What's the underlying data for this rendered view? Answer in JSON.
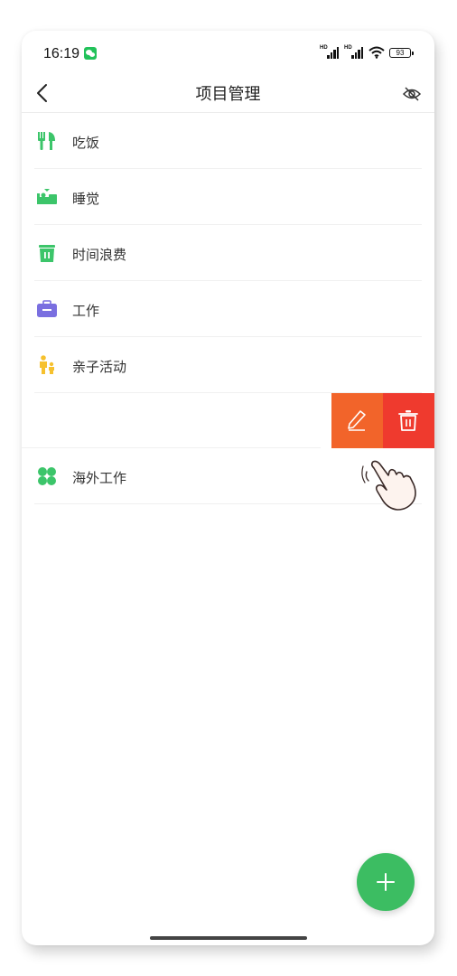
{
  "status_bar": {
    "time": "16:19",
    "hd1": "HD",
    "hd2": "HD",
    "battery": "93"
  },
  "nav": {
    "title": "项目管理"
  },
  "items": [
    {
      "label": "吃饭",
      "icon": "fork-knife-icon",
      "color": "#3cc56a"
    },
    {
      "label": "睡觉",
      "icon": "bed-icon",
      "color": "#3cc56a"
    },
    {
      "label": "时间浪费",
      "icon": "trash-bin-icon",
      "color": "#3cc56a"
    },
    {
      "label": "工作",
      "icon": "briefcase-icon",
      "color": "#7a6fe0"
    },
    {
      "label": "亲子活动",
      "icon": "parent-child-icon",
      "color": "#f6c12e"
    },
    {
      "label": "",
      "icon": "",
      "color": ""
    },
    {
      "label": "海外工作",
      "icon": "clover-icon",
      "color": "#3cc56a"
    }
  ],
  "swipe_actions": {
    "edit_icon": "pencil-icon",
    "edit_color": "#f2642a",
    "delete_icon": "trash-icon",
    "delete_color": "#ef3a2e"
  },
  "fab": {
    "icon": "plus-icon",
    "color": "#3cbd62"
  }
}
